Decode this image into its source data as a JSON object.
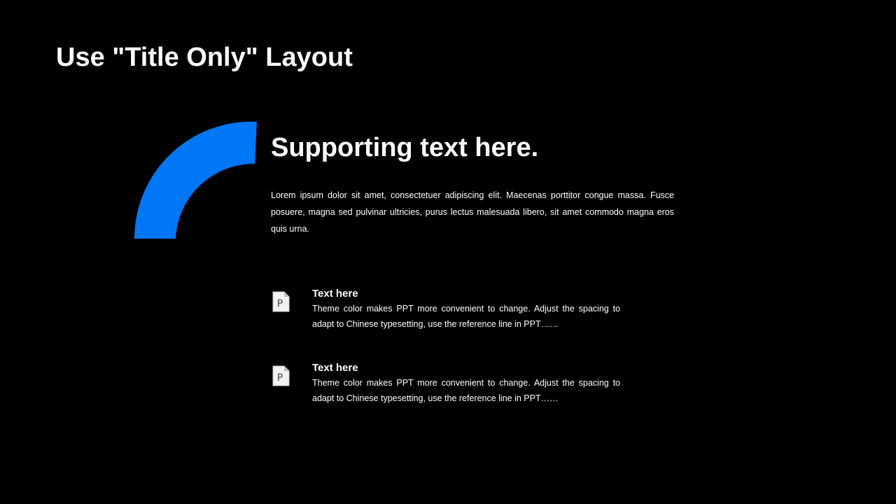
{
  "slide": {
    "title": "Use \"Title Only\" Layout",
    "accent_color": "#0077F7"
  },
  "content": {
    "heading": "Supporting text here.",
    "body": "Lorem ipsum dolor sit amet, consectetuer adipiscing elit. Maecenas porttitor congue massa. Fusce posuere, magna sed pulvinar ultricies, purus lectus malesuada libero, sit amet commodo magna eros quis urna."
  },
  "features": [
    {
      "icon": "document-p-icon",
      "icon_letter": "P",
      "title": "Text here",
      "description": "Theme color makes PPT more convenient to change. Adjust the spacing to adapt to Chinese typesetting, use the reference line in PPT……"
    },
    {
      "icon": "document-p-icon",
      "icon_letter": "P",
      "title": "Text here",
      "description": "Theme color makes PPT more convenient to change. Adjust the spacing to adapt to Chinese typesetting, use the reference line in PPT……"
    }
  ]
}
